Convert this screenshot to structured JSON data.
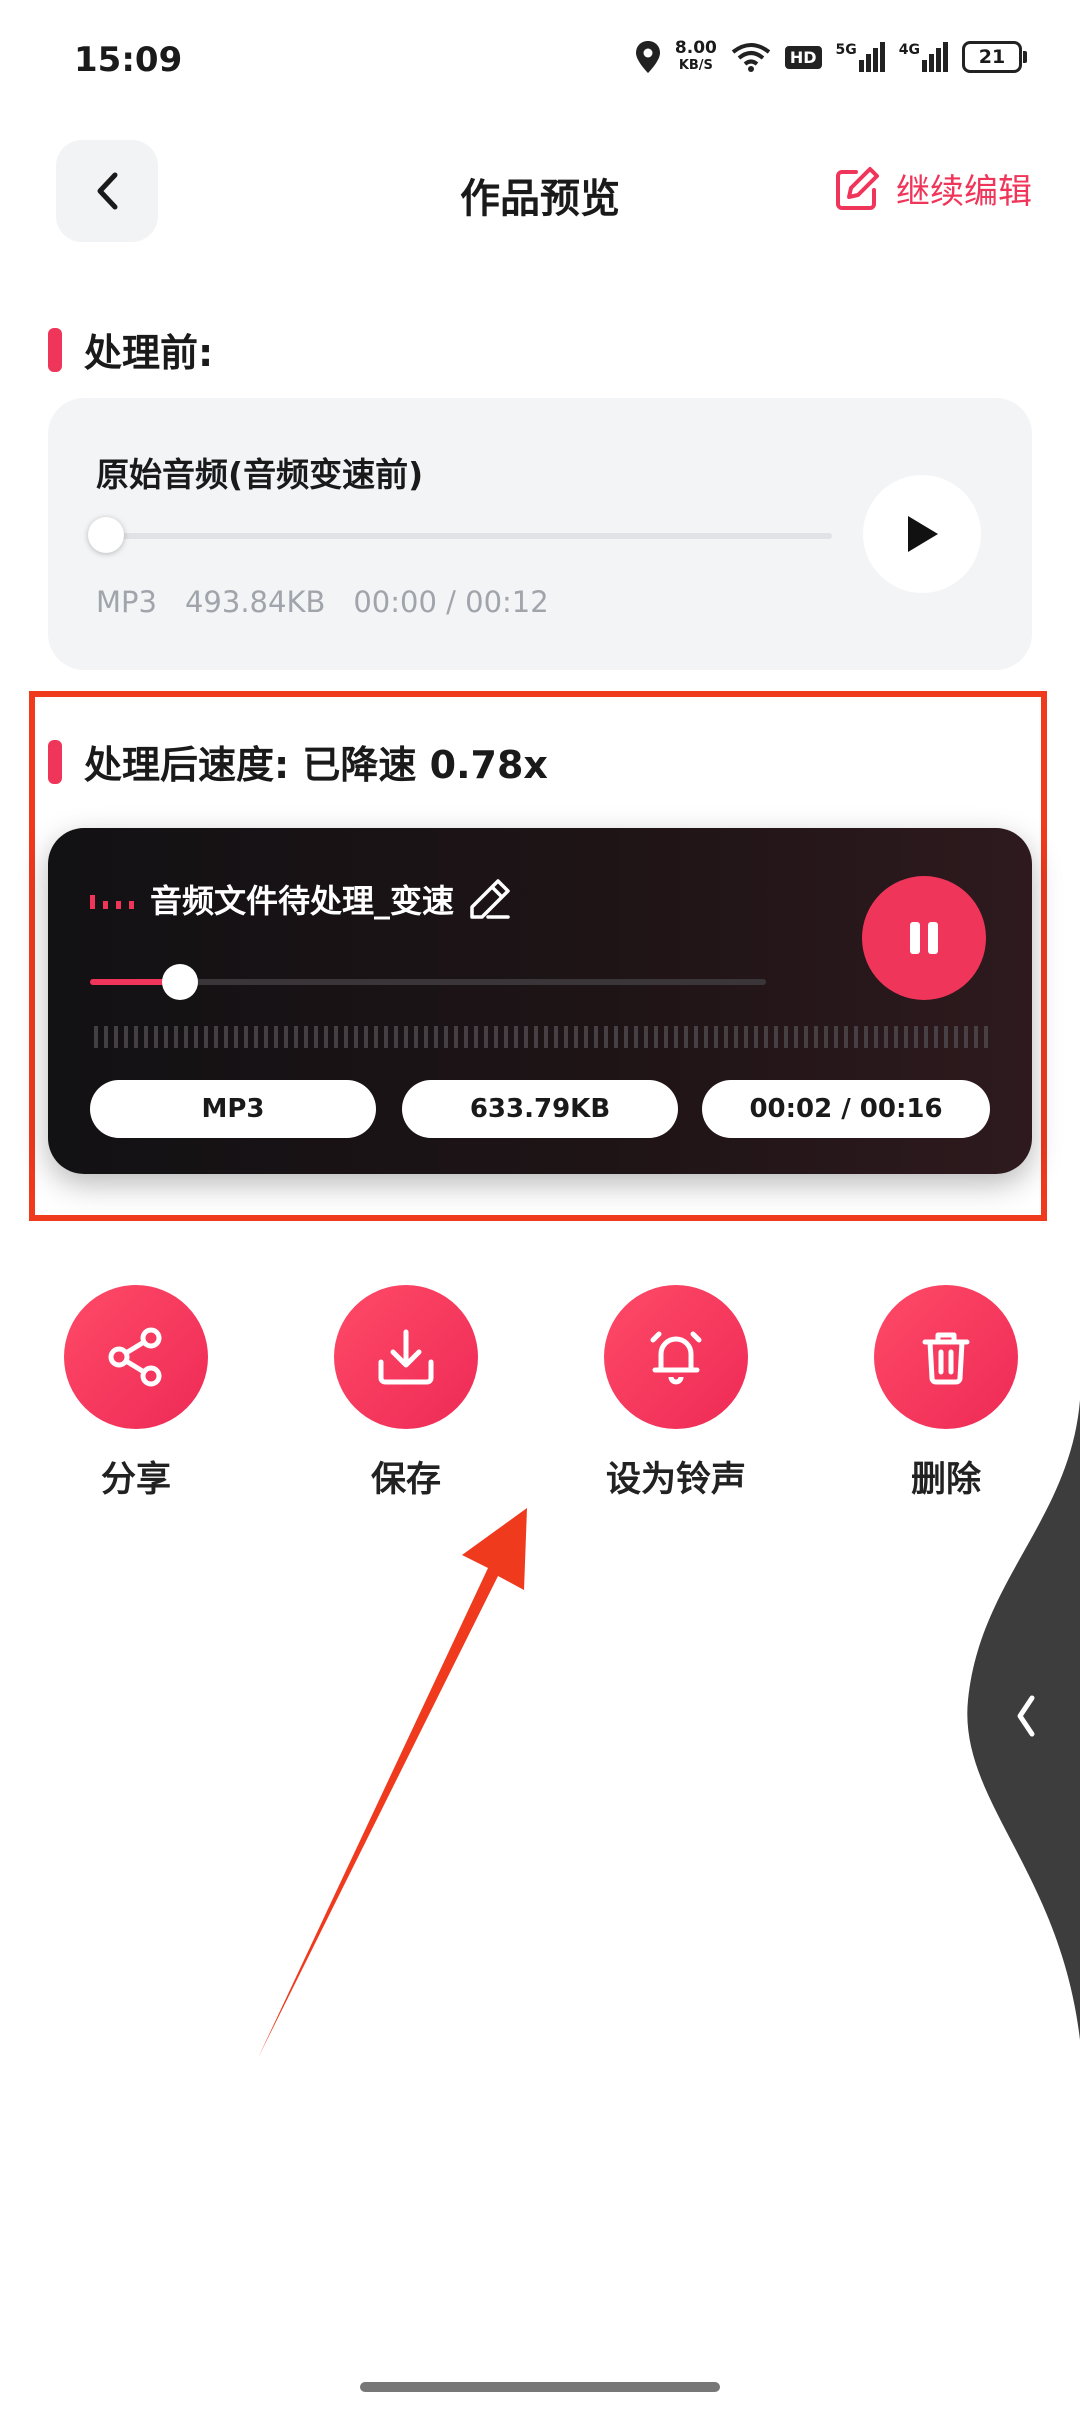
{
  "status_bar": {
    "time": "15:09",
    "net_speed_value": "8.00",
    "net_speed_unit": "KB/S",
    "hd": "HD",
    "sig1": "5G",
    "sig2": "4G",
    "battery": "21"
  },
  "header": {
    "title": "作品预览",
    "edit_label": "继续编辑"
  },
  "before": {
    "heading": "处理前:",
    "card_title": "原始音频(音频变速前)",
    "format": "MP3",
    "size": "493.84KB",
    "time": "00:00 / 00:12",
    "progress": 0
  },
  "after": {
    "heading": "处理后速度: 已降速 0.78x",
    "file_name": "音频文件待处理_变速",
    "format": "MP3",
    "size": "633.79KB",
    "time": "00:02 / 00:16",
    "progress": 0.125
  },
  "actions": [
    {
      "label": "分享",
      "icon": "share-icon"
    },
    {
      "label": "保存",
      "icon": "download-icon"
    },
    {
      "label": "设为铃声",
      "icon": "alarm-bell-icon"
    },
    {
      "label": "删除",
      "icon": "trash-icon"
    }
  ],
  "colors": {
    "accent": "#f0355a",
    "annotation": "#f03a1e",
    "card_dark": "#1a1416"
  }
}
